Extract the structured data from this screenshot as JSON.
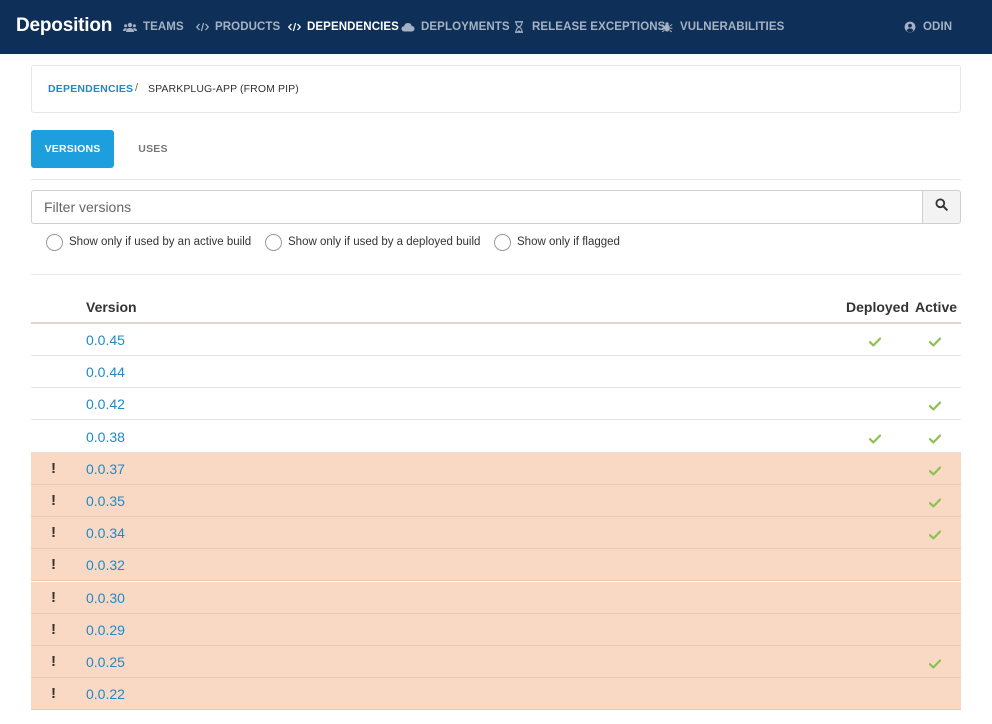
{
  "brand": "Deposition",
  "nav": {
    "teams": "TEAMS",
    "products": "PRODUCTS",
    "dependencies": "DEPENDENCIES",
    "deployments": "DEPLOYMENTS",
    "release_exceptions": "RELEASE EXCEPTIONS",
    "vulnerabilities": "VULNERABILITIES",
    "user": "ODIN"
  },
  "breadcrumb": {
    "link": "DEPENDENCIES",
    "separator": "/",
    "current": "SPARKPLUG-APP (FROM PIP)"
  },
  "tabs": {
    "versions": "VERSIONS",
    "uses": "USES"
  },
  "filter": {
    "placeholder": "Filter versions",
    "options": [
      "Show only if used by an active build",
      "Show only if used by a deployed build",
      "Show only if flagged"
    ]
  },
  "table": {
    "headers": {
      "version": "Version",
      "deployed": "Deployed",
      "active": "Active"
    },
    "flag_symbol": "!",
    "rows": [
      {
        "version": "0.0.45",
        "flagged": false,
        "deployed": true,
        "active": true
      },
      {
        "version": "0.0.44",
        "flagged": false,
        "deployed": false,
        "active": false
      },
      {
        "version": "0.0.42",
        "flagged": false,
        "deployed": false,
        "active": true
      },
      {
        "version": "0.0.38",
        "flagged": false,
        "deployed": true,
        "active": true
      },
      {
        "version": "0.0.37",
        "flagged": true,
        "deployed": false,
        "active": true
      },
      {
        "version": "0.0.35",
        "flagged": true,
        "deployed": false,
        "active": true
      },
      {
        "version": "0.0.34",
        "flagged": true,
        "deployed": false,
        "active": true
      },
      {
        "version": "0.0.32",
        "flagged": true,
        "deployed": false,
        "active": false
      },
      {
        "version": "0.0.30",
        "flagged": true,
        "deployed": false,
        "active": false
      },
      {
        "version": "0.0.29",
        "flagged": true,
        "deployed": false,
        "active": false
      },
      {
        "version": "0.0.25",
        "flagged": true,
        "deployed": false,
        "active": true
      },
      {
        "version": "0.0.22",
        "flagged": true,
        "deployed": false,
        "active": false
      }
    ]
  },
  "colors": {
    "navbar": "#0e2f57",
    "accent": "#1c9fdc",
    "link": "#1e8ac8",
    "flagged_row": "#f9d9c4",
    "check": "#8cc152"
  },
  "icons": {
    "teams": "users-icon",
    "products": "code-icon",
    "dependencies": "code-icon",
    "deployments": "cloud-icon",
    "release_exceptions": "hourglass-icon",
    "vulnerabilities": "bug-icon",
    "user": "user-circle-icon",
    "search": "search-icon",
    "check": "check-icon",
    "flag": "exclamation-icon"
  }
}
